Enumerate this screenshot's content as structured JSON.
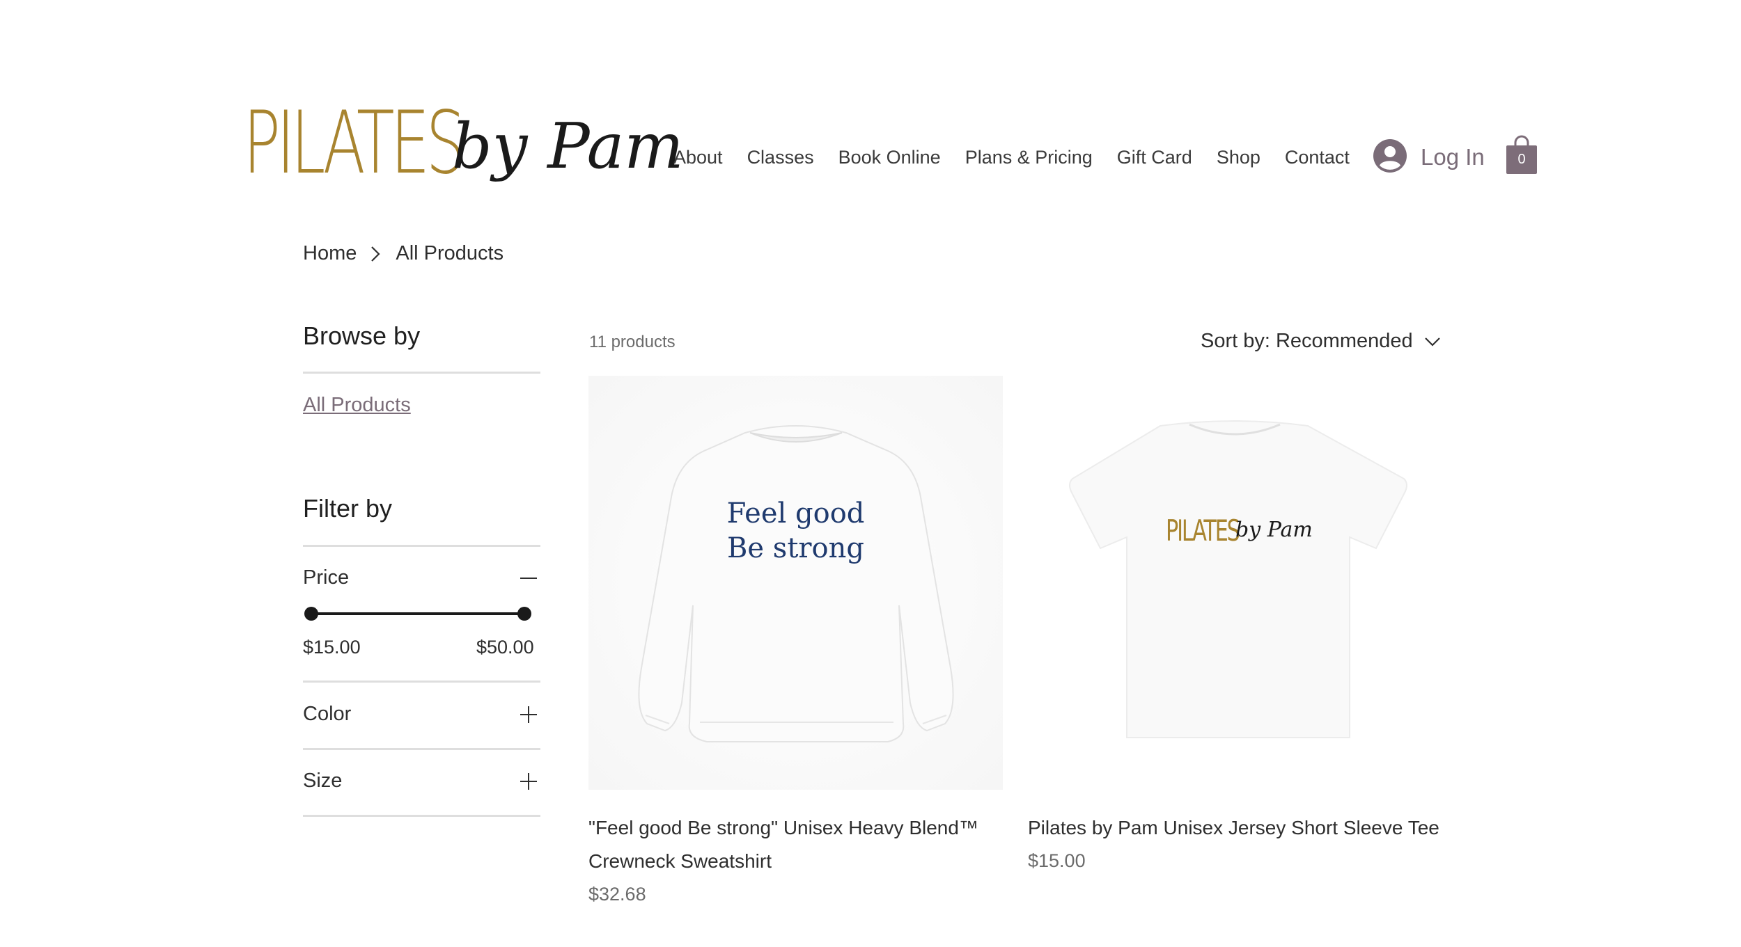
{
  "brand": {
    "logo_main": "PILATES",
    "logo_script": "by Pam",
    "gold": "#a8842f"
  },
  "nav": {
    "items": [
      "About",
      "Classes",
      "Book Online",
      "Plans & Pricing",
      "Gift Card",
      "Shop",
      "Contact"
    ]
  },
  "account": {
    "login_label": "Log In",
    "icon": "user-avatar-icon",
    "accent": "#7a6c78"
  },
  "cart": {
    "count": "0",
    "icon": "shopping-bag-icon",
    "color": "#7d6d79"
  },
  "breadcrumb": {
    "home": "Home",
    "current": "All Products"
  },
  "sidebar": {
    "browse_title": "Browse by",
    "all_products": "All Products",
    "filter_title": "Filter by",
    "price": {
      "label": "Price",
      "min": "$15.00",
      "max": "$50.00",
      "range_selected": [
        0,
        1
      ]
    },
    "color": {
      "label": "Color"
    },
    "size": {
      "label": "Size"
    }
  },
  "listing": {
    "count_text": "11 products",
    "sort_label": "Sort by: Recommended"
  },
  "products": [
    {
      "name_line1": "\"Feel good Be strong\" Unisex Heavy Blend™",
      "name_line2": "Crewneck Sweatshirt",
      "price": "$32.68",
      "print_line1": "Feel good",
      "print_line2": "Be strong"
    },
    {
      "name": "Pilates by Pam Unisex Jersey Short Sleeve Tee",
      "price": "$15.00",
      "print_main": "PILATES",
      "print_script": "by Pam"
    }
  ]
}
